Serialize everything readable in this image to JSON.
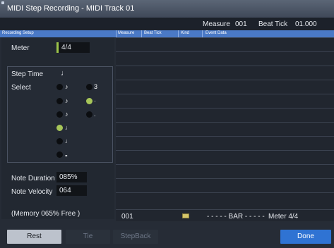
{
  "window": {
    "title": "MIDI Step Recording - MIDI Track 01"
  },
  "info": {
    "measure_label": "Measure",
    "measure_value": "001",
    "beat_tick_label": "Beat Tick",
    "beat_tick_value": "01.000"
  },
  "header": {
    "section": "Recording Setup",
    "columns": [
      "Measure",
      "Beat Tick",
      "Kind",
      "Event Data"
    ]
  },
  "setup": {
    "meter_label": "Meter",
    "meter_value": "4/4",
    "step_time_label": "Step Time",
    "step_time_symbol": "♩",
    "select_label": "Select",
    "options": [
      {
        "glyph": "♪",
        "selected": false
      },
      {
        "glyph": "3",
        "selected": false
      },
      {
        "glyph": "♪",
        "selected": false
      },
      {
        "glyph": "·",
        "selected": true
      },
      {
        "glyph": "♪",
        "selected": false
      },
      {
        "glyph": ".",
        "selected": false
      },
      {
        "glyph": "♩",
        "selected": true
      },
      {
        "glyph": "♩",
        "selected": false
      },
      {
        "glyph": "𝅝",
        "selected": false
      }
    ],
    "note_duration_label": "Note Duration",
    "note_duration_value": "085%",
    "note_velocity_label": "Note Velocity",
    "note_velocity_value": "064",
    "memory_text": "(Memory   065% Free    )"
  },
  "status": {
    "measure": "001",
    "bar_text": "- - - - - BAR - - - - -",
    "meter_text": "Meter  4/4"
  },
  "buttons": {
    "rest": "Rest",
    "tie": "Tie",
    "stepback": "StepBack",
    "done": "Done"
  },
  "colors": {
    "accent": "#4a79c6",
    "selected": "#a7c659",
    "done": "#2f73d3"
  }
}
